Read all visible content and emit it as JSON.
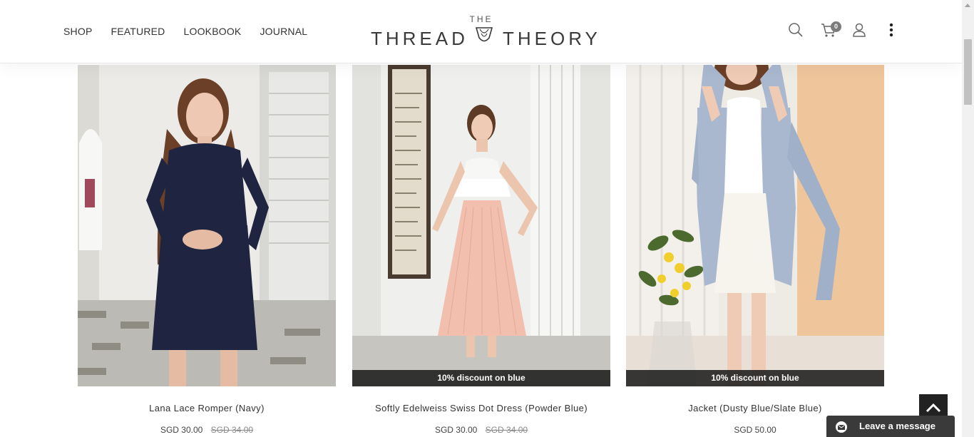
{
  "nav": {
    "items": [
      "SHOP",
      "FEATURED",
      "LOOKBOOK",
      "JOURNAL"
    ]
  },
  "logo": {
    "top": "THE",
    "word1": "THREAD",
    "word2": "THEORY"
  },
  "header_icons": {
    "search": "search-icon",
    "cart": "cart-icon",
    "cart_count": "0",
    "account": "user-icon",
    "more": "more-vertical-icon"
  },
  "products": [
    {
      "name": "Lana Lace Romper (Navy)",
      "price": "SGD 30.00",
      "old_price": "SGD 34.00",
      "badge": ""
    },
    {
      "name": "Softly Edelweiss Swiss Dot Dress (Powder Blue)",
      "price": "SGD 30.00",
      "old_price": "SGD 34.00",
      "badge": "10% discount on blue"
    },
    {
      "name": "Jacket (Dusty Blue/Slate Blue)",
      "price": "SGD 50.00",
      "old_price": "",
      "badge": "10% discount on blue"
    }
  ],
  "chat": {
    "label": "Leave a message"
  },
  "colors": {
    "badge_bg": "#1e1e1e",
    "chat_bg": "#3a3a3a",
    "navy": "#1f2540",
    "blush": "#f2bfae",
    "dusty_blue": "#a9b8cf"
  }
}
